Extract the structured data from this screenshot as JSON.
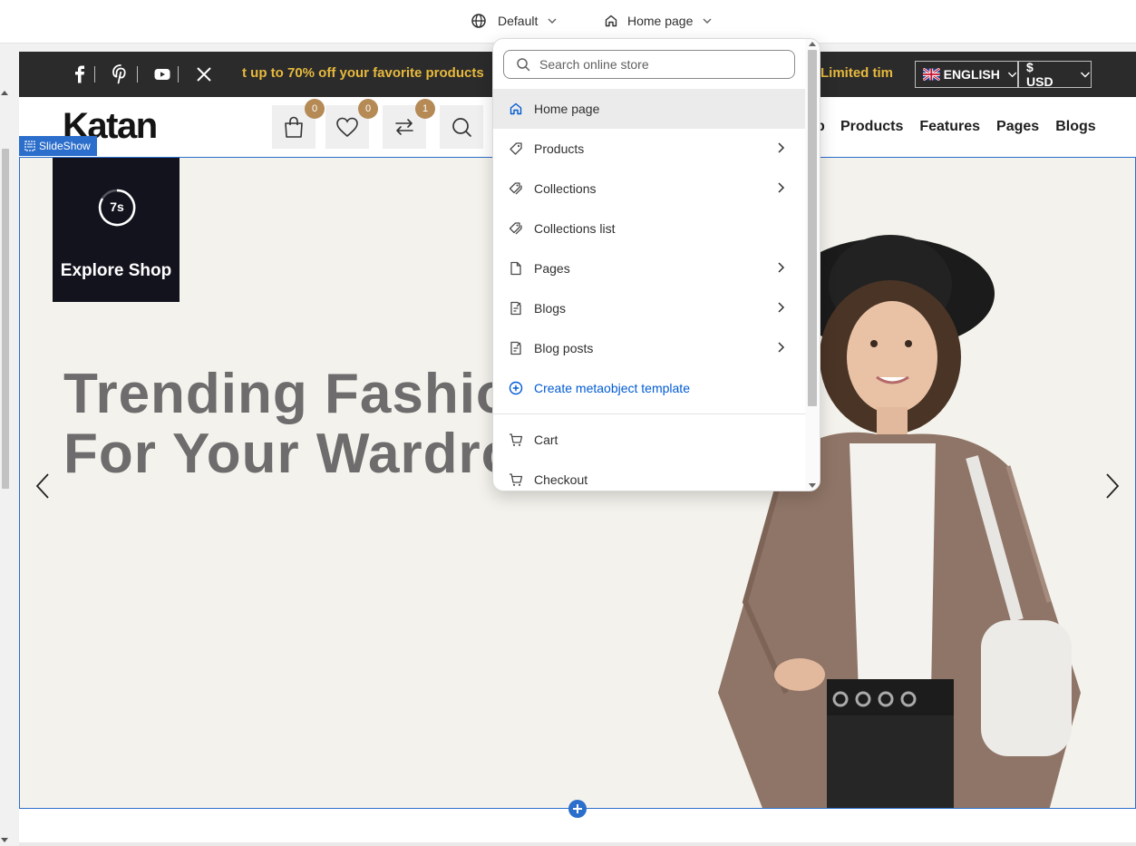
{
  "topbar": {
    "theme_label": "Default",
    "page_label": "Home page"
  },
  "announcement": {
    "promo_text": "t up to 70% off your favorite products",
    "promo_text_2": "Limited time",
    "language": "ENGLISH",
    "currency": "$ USD",
    "promo_color": "#e7b93d"
  },
  "header": {
    "logo": "Katan",
    "cart_count": "0",
    "wishlist_count": "0",
    "compare_count": "1",
    "nav_clipped": "p",
    "nav": [
      "Products",
      "Features",
      "Pages",
      "Blogs"
    ]
  },
  "slideshow": {
    "tag": "SlideShow",
    "timer": "7s",
    "explore_label": "Explore Shop",
    "headline_line1": "Trending Fashion",
    "headline_line2": "For Your Wardrob"
  },
  "dropdown": {
    "search_placeholder": "Search online store",
    "items": [
      {
        "label": "Home page",
        "icon": "home-icon",
        "active": true
      },
      {
        "label": "Products",
        "icon": "tag-icon"
      },
      {
        "label": "Collections",
        "icon": "tags-icon"
      },
      {
        "label": "Collections list",
        "icon": "tags-icon"
      },
      {
        "label": "Pages",
        "icon": "page-icon"
      },
      {
        "label": "Blogs",
        "icon": "blog-icon"
      },
      {
        "label": "Blog posts",
        "icon": "blog-icon"
      },
      {
        "label": "Create metaobject template",
        "icon": "plus-circle-icon"
      },
      {
        "label": "Cart",
        "icon": "cart-icon"
      },
      {
        "label": "Checkout",
        "icon": "cart-icon"
      }
    ]
  },
  "colors": {
    "accent": "#2c6ecb",
    "badge": "#b58a55",
    "link": "#005bd3"
  }
}
